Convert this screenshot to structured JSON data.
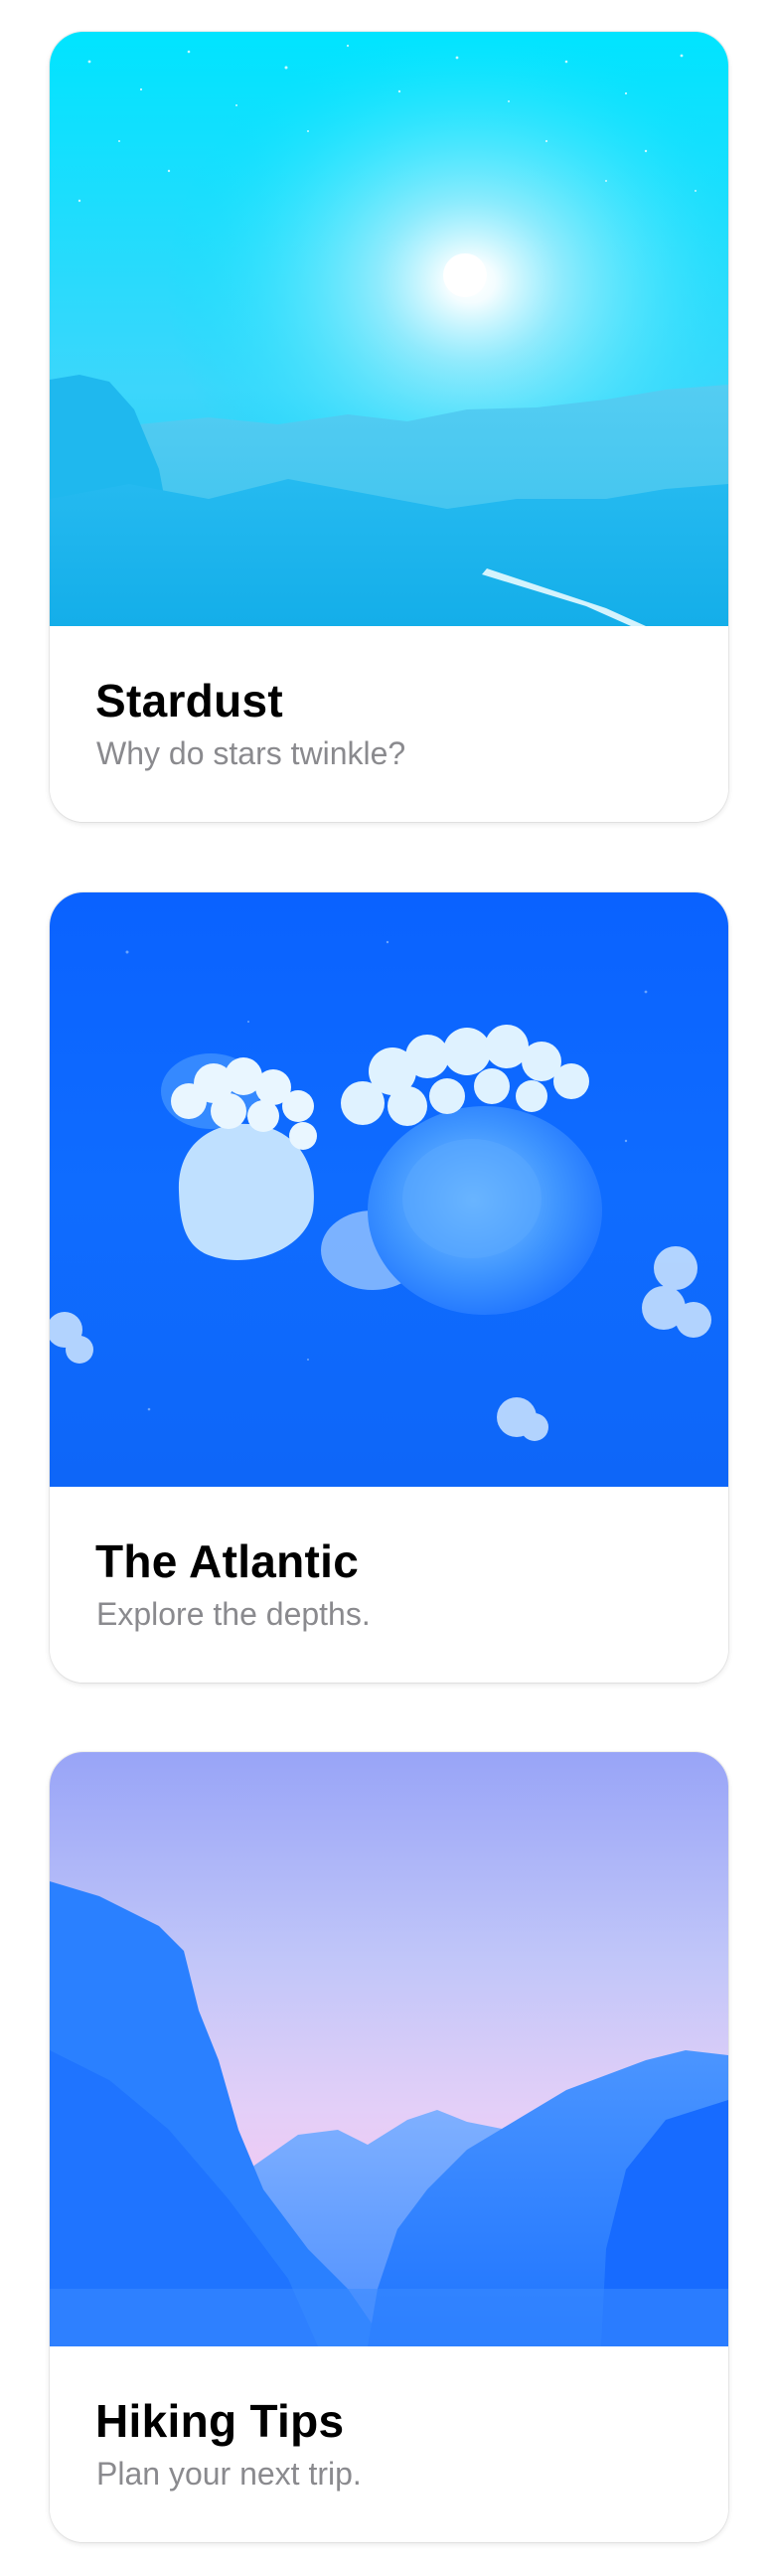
{
  "cards": [
    {
      "title": "Stardust",
      "subtitle": "Why do stars twinkle?",
      "image": "night-sky-mountains-photo",
      "tint": "#00e1ff"
    },
    {
      "title": "The Atlantic",
      "subtitle": "Explore the depths.",
      "image": "jellyfish-underwater-photo",
      "tint": "#0a66ff"
    },
    {
      "title": "Hiking Tips",
      "subtitle": "Plan your next trip.",
      "image": "valley-cliffs-dusk-photo",
      "tint": "#9aa2f8"
    }
  ]
}
